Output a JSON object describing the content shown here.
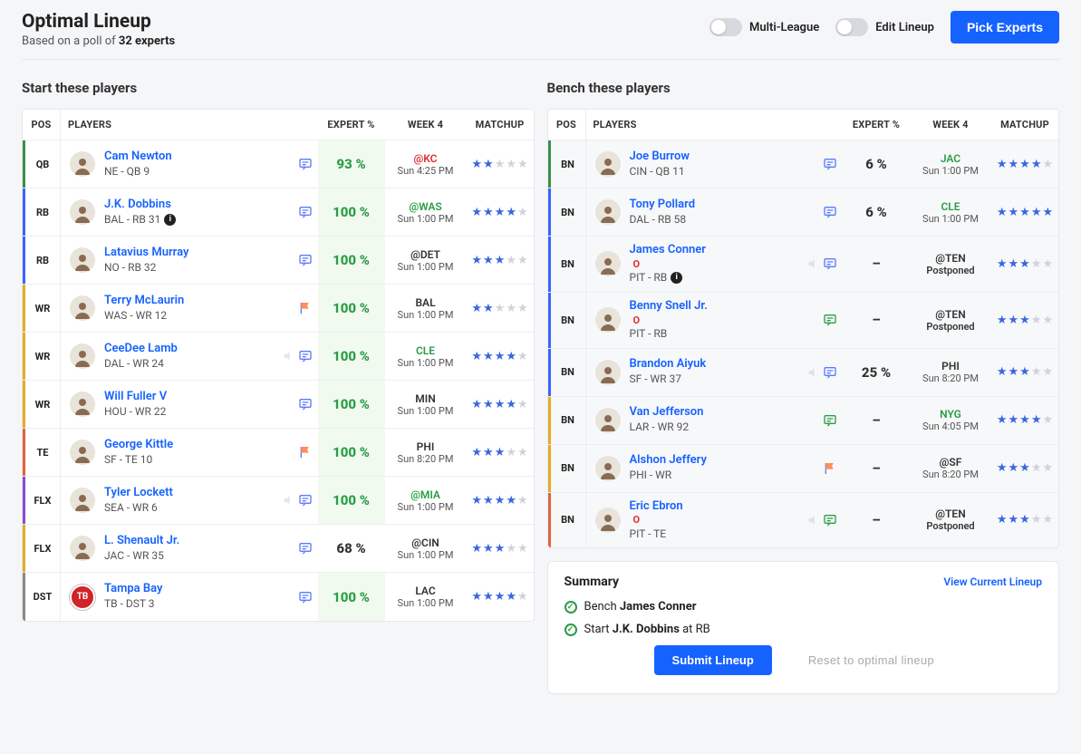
{
  "header": {
    "title": "Optimal Lineup",
    "subtitle_pre": "Based on a poll of ",
    "subtitle_bold": "32 experts",
    "toggle_multi": "Multi-League",
    "toggle_edit": "Edit Lineup",
    "pick_experts_btn": "Pick Experts"
  },
  "sections": {
    "start": "Start these players",
    "bench": "Bench these players"
  },
  "columns": {
    "pos": "POS",
    "players": "PLAYERS",
    "expert": "EXPERT %",
    "week": "WEEK 4",
    "matchup": "MATCHUP"
  },
  "start_rows": [
    {
      "pos": "QB",
      "posClass": "pos-QB",
      "name": "Cam Newton",
      "meta": "NE - QB 9",
      "info": false,
      "status": "",
      "icons": [
        "chat"
      ],
      "pct": "93 %",
      "pctHl": true,
      "pctGreen": true,
      "opp": "@KC",
      "oppClass": "red",
      "time": "Sun 4:25 PM",
      "post": false,
      "stars": 2
    },
    {
      "pos": "RB",
      "posClass": "pos-RB",
      "name": "J.K. Dobbins",
      "meta": "BAL - RB 31",
      "info": true,
      "status": "",
      "icons": [
        "chat"
      ],
      "pct": "100 %",
      "pctHl": true,
      "pctGreen": true,
      "opp": "@WAS",
      "oppClass": "green",
      "time": "Sun 1:00 PM",
      "post": false,
      "stars": 4
    },
    {
      "pos": "RB",
      "posClass": "pos-RB",
      "name": "Latavius Murray",
      "meta": "NO - RB 32",
      "info": false,
      "status": "",
      "icons": [
        "chat"
      ],
      "pct": "100 %",
      "pctHl": true,
      "pctGreen": true,
      "opp": "@DET",
      "oppClass": "gray",
      "time": "Sun 1:00 PM",
      "post": false,
      "stars": 3
    },
    {
      "pos": "WR",
      "posClass": "pos-WR",
      "name": "Terry McLaurin",
      "meta": "WAS - WR 12",
      "info": false,
      "status": "",
      "icons": [
        "flag"
      ],
      "pct": "100 %",
      "pctHl": true,
      "pctGreen": true,
      "opp": "BAL",
      "oppClass": "gray",
      "time": "Sun 1:00 PM",
      "post": false,
      "stars": 2
    },
    {
      "pos": "WR",
      "posClass": "pos-WR",
      "name": "CeeDee Lamb",
      "meta": "DAL - WR 24",
      "info": false,
      "status": "",
      "icons": [
        "mute",
        "chat"
      ],
      "pct": "100 %",
      "pctHl": true,
      "pctGreen": true,
      "opp": "CLE",
      "oppClass": "green",
      "time": "Sun 1:00 PM",
      "post": false,
      "stars": 4
    },
    {
      "pos": "WR",
      "posClass": "pos-WR",
      "name": "Will Fuller V",
      "meta": "HOU - WR 22",
      "info": false,
      "status": "",
      "icons": [
        "chat"
      ],
      "pct": "100 %",
      "pctHl": true,
      "pctGreen": true,
      "opp": "MIN",
      "oppClass": "gray",
      "time": "Sun 1:00 PM",
      "post": false,
      "stars": 4
    },
    {
      "pos": "TE",
      "posClass": "pos-TE",
      "name": "George Kittle",
      "meta": "SF - TE 10",
      "info": false,
      "status": "",
      "icons": [
        "flag"
      ],
      "pct": "100 %",
      "pctHl": true,
      "pctGreen": true,
      "opp": "PHI",
      "oppClass": "gray",
      "time": "Sun 8:20 PM",
      "post": false,
      "stars": 3
    },
    {
      "pos": "FLX",
      "posClass": "pos-FLX2",
      "name": "Tyler Lockett",
      "meta": "SEA - WR 6",
      "info": false,
      "status": "",
      "icons": [
        "mute",
        "chat"
      ],
      "pct": "100 %",
      "pctHl": true,
      "pctGreen": true,
      "opp": "@MIA",
      "oppClass": "green",
      "time": "Sun 1:00 PM",
      "post": false,
      "stars": 4
    },
    {
      "pos": "FLX",
      "posClass": "pos-WR",
      "name": "L. Shenault Jr.",
      "meta": "JAC - WR 35",
      "info": false,
      "status": "",
      "icons": [
        "chat"
      ],
      "pct": "68 %",
      "pctHl": false,
      "pctGreen": false,
      "opp": "@CIN",
      "oppClass": "gray",
      "time": "Sun 1:00 PM",
      "post": false,
      "stars": 3
    },
    {
      "pos": "DST",
      "posClass": "pos-DST",
      "name": "Tampa Bay",
      "meta": "TB - DST 3",
      "info": false,
      "status": "",
      "icons": [
        "chat"
      ],
      "logo": "TB",
      "pct": "100 %",
      "pctHl": true,
      "pctGreen": true,
      "opp": "LAC",
      "oppClass": "gray",
      "time": "Sun 1:00 PM",
      "post": false,
      "stars": 4
    }
  ],
  "bench_rows": [
    {
      "pos": "BN",
      "bar": "pos-QB",
      "name": "Joe Burrow",
      "meta": "CIN - QB 11",
      "info": false,
      "status": "",
      "icons": [
        "chat"
      ],
      "pct": "6 %",
      "pctHl": false,
      "pctGreen": false,
      "opp": "JAC",
      "oppClass": "green",
      "time": "Sun 1:00 PM",
      "post": false,
      "stars": 4
    },
    {
      "pos": "BN",
      "bar": "pos-RB",
      "name": "Tony Pollard",
      "meta": "DAL - RB 58",
      "info": false,
      "status": "",
      "icons": [
        "chat"
      ],
      "pct": "6 %",
      "pctHl": false,
      "pctGreen": false,
      "opp": "CLE",
      "oppClass": "green",
      "time": "Sun 1:00 PM",
      "post": false,
      "stars": 5
    },
    {
      "pos": "BN",
      "bar": "pos-RB",
      "name": "James Conner",
      "meta": "PIT - RB",
      "info": true,
      "status": "O",
      "icons": [
        "mute",
        "chat"
      ],
      "pct": "–",
      "pctHl": false,
      "pctGreen": false,
      "opp": "@TEN",
      "oppClass": "gray",
      "time": "",
      "post": true,
      "stars": 3
    },
    {
      "pos": "BN",
      "bar": "pos-RB",
      "name": "Benny Snell Jr.",
      "meta": "PIT - RB",
      "info": false,
      "status": "O",
      "icons": [
        "chatg"
      ],
      "pct": "–",
      "pctHl": false,
      "pctGreen": false,
      "opp": "@TEN",
      "oppClass": "gray",
      "time": "",
      "post": true,
      "stars": 3
    },
    {
      "pos": "BN",
      "bar": "pos-RB",
      "name": "Brandon Aiyuk",
      "meta": "SF - WR 37",
      "info": false,
      "status": "",
      "icons": [
        "mute",
        "chat"
      ],
      "pct": "25 %",
      "pctHl": false,
      "pctGreen": false,
      "opp": "PHI",
      "oppClass": "gray",
      "time": "Sun 8:20 PM",
      "post": false,
      "stars": 3
    },
    {
      "pos": "BN",
      "bar": "pos-WR",
      "name": "Van Jefferson",
      "meta": "LAR - WR 92",
      "info": false,
      "status": "",
      "icons": [
        "chatg"
      ],
      "pct": "–",
      "pctHl": false,
      "pctGreen": false,
      "opp": "NYG",
      "oppClass": "green",
      "time": "Sun 4:05 PM",
      "post": false,
      "stars": 4
    },
    {
      "pos": "BN",
      "bar": "pos-WR",
      "name": "Alshon Jeffery",
      "meta": "PHI - WR",
      "info": false,
      "status": "",
      "icons": [
        "flag"
      ],
      "pct": "–",
      "pctHl": false,
      "pctGreen": false,
      "opp": "@SF",
      "oppClass": "gray",
      "time": "Sun 8:20 PM",
      "post": false,
      "stars": 3
    },
    {
      "pos": "BN",
      "bar": "pos-TE",
      "name": "Eric Ebron",
      "meta": "PIT - TE",
      "info": false,
      "status": "O",
      "icons": [
        "mute",
        "chatg"
      ],
      "pct": "–",
      "pctHl": false,
      "pctGreen": false,
      "opp": "@TEN",
      "oppClass": "gray",
      "time": "",
      "post": true,
      "stars": 3
    }
  ],
  "summary": {
    "title": "Summary",
    "view_link": "View Current Lineup",
    "line1_pre": "Bench ",
    "line1_bold": "James Conner",
    "line2_pre": "Start ",
    "line2_bold": "J.K. Dobbins",
    "line2_post": " at RB",
    "submit": "Submit Lineup",
    "reset": "Reset to optimal lineup"
  },
  "misc": {
    "postponed": "Postponed"
  }
}
